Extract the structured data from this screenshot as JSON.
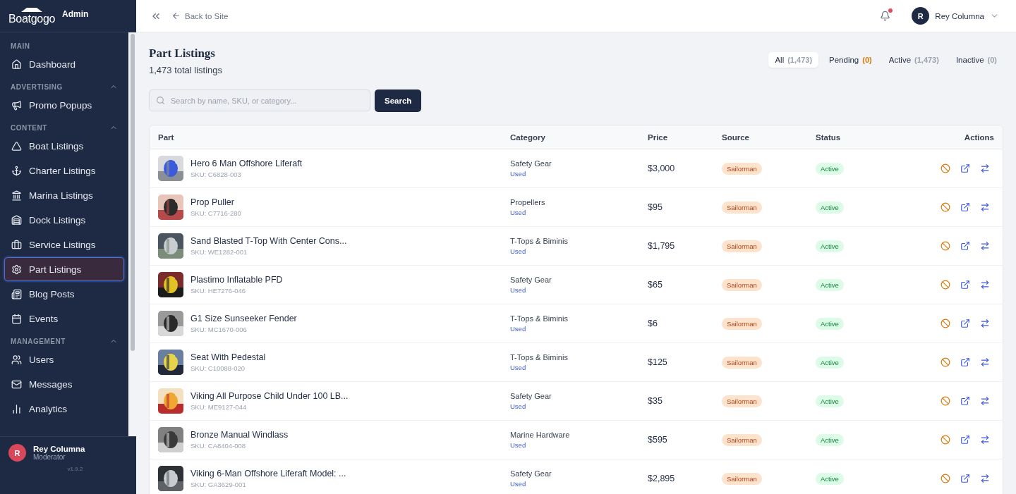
{
  "sidebar": {
    "logo": "Boatgogo",
    "badge": "Admin",
    "sections": [
      {
        "title": "MAIN",
        "items": [
          {
            "label": "Dashboard",
            "selected": false
          }
        ]
      },
      {
        "title": "ADVERTISING",
        "expanded": true,
        "items": [
          {
            "label": "Promo Popups",
            "selected": false
          }
        ]
      },
      {
        "title": "CONTENT",
        "expanded": true,
        "items": [
          {
            "label": "Boat Listings",
            "selected": false
          },
          {
            "label": "Charter Listings",
            "selected": false
          },
          {
            "label": "Marina Listings",
            "selected": false
          },
          {
            "label": "Dock Listings",
            "selected": false
          },
          {
            "label": "Service Listings",
            "selected": false
          },
          {
            "label": "Part Listings",
            "selected": true
          },
          {
            "label": "Blog Posts",
            "selected": false
          },
          {
            "label": "Events",
            "selected": false
          }
        ]
      },
      {
        "title": "MANAGEMENT",
        "expanded": true,
        "items": [
          {
            "label": "Users",
            "selected": false
          },
          {
            "label": "Messages",
            "selected": false
          },
          {
            "label": "Analytics",
            "selected": false
          }
        ]
      }
    ],
    "user": {
      "initial": "R",
      "name": "Rey Columna",
      "role": "Moderator",
      "version": "v1.9.2"
    }
  },
  "topbar": {
    "back_link": "Back to Site",
    "notification": true,
    "user": {
      "initial": "R",
      "name": "Rey Columna"
    }
  },
  "page": {
    "title": "Part Listings",
    "subtitle": "1,473 total listings"
  },
  "tabs": [
    {
      "label": "All",
      "count": "(1,473)",
      "selected": true,
      "color": "#9ca3af"
    },
    {
      "label": "Pending",
      "count": "(0)",
      "selected": false,
      "color": "#d97706"
    },
    {
      "label": "Active",
      "count": "(1,473)",
      "selected": false,
      "color": "#9ca3af"
    },
    {
      "label": "Inactive",
      "count": "(0)",
      "selected": false,
      "color": "#9ca3af"
    }
  ],
  "search": {
    "placeholder": "Search by name, SKU, or category...",
    "button": "Search"
  },
  "table": {
    "columns": [
      "Part",
      "Category",
      "Price",
      "Source",
      "Status",
      "Actions"
    ],
    "rows": [
      {
        "name": "Hero 6 Man Offshore Liferaft",
        "sku": "SKU: C6828-003",
        "category": "Safety Gear",
        "condition": "Used",
        "price": "$3,000",
        "source": "Sailorman",
        "status": "Active"
      },
      {
        "name": "Prop Puller",
        "sku": "SKU: C7716-280",
        "category": "Propellers",
        "condition": "Used",
        "price": "$95",
        "source": "Sailorman",
        "status": "Active"
      },
      {
        "name": "Sand Blasted T-Top With Center Cons...",
        "sku": "SKU: WE1282-001",
        "category": "T-Tops & Biminis",
        "condition": "Used",
        "price": "$1,795",
        "source": "Sailorman",
        "status": "Active"
      },
      {
        "name": "Plastimo Inflatable PFD",
        "sku": "SKU: HE7276-046",
        "category": "Safety Gear",
        "condition": "Used",
        "price": "$65",
        "source": "Sailorman",
        "status": "Active"
      },
      {
        "name": "G1 Size Sunseeker Fender",
        "sku": "SKU: MC1670-006",
        "category": "T-Tops & Biminis",
        "condition": "Used",
        "price": "$6",
        "source": "Sailorman",
        "status": "Active"
      },
      {
        "name": "Seat With Pedestal",
        "sku": "SKU: C10088-020",
        "category": "T-Tops & Biminis",
        "condition": "Used",
        "price": "$125",
        "source": "Sailorman",
        "status": "Active"
      },
      {
        "name": "Viking All Purpose Child Under 100 LB...",
        "sku": "SKU: ME9127-044",
        "category": "Safety Gear",
        "condition": "Used",
        "price": "$35",
        "source": "Sailorman",
        "status": "Active"
      },
      {
        "name": "Bronze Manual Windlass",
        "sku": "SKU: CA8404-008",
        "category": "Marine Hardware",
        "condition": "Used",
        "price": "$595",
        "source": "Sailorman",
        "status": "Active"
      },
      {
        "name": "Viking 6-Man Offshore Liferaft Model: ...",
        "sku": "SKU: GA3629-001",
        "category": "Safety Gear",
        "condition": "Used",
        "price": "$2,895",
        "source": "Sailorman",
        "status": "Active"
      }
    ]
  }
}
